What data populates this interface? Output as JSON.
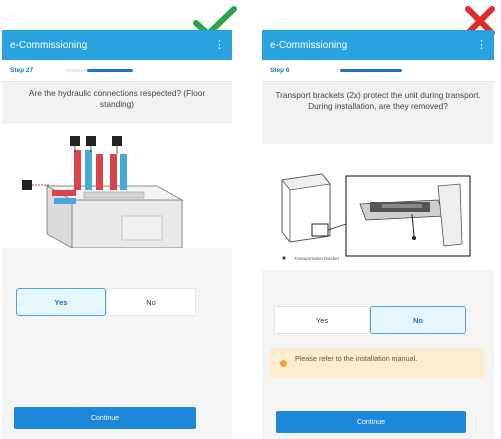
{
  "left_screen": {
    "verdict_icon": "checkmark-icon",
    "verdict_color": "#2aa448",
    "app_title": "e-Commissioning",
    "step_label": "Step 27",
    "question": "Are the hydraulic connections respected? (Floor standing)",
    "choices": {
      "yes": "Yes",
      "no": "No"
    },
    "selected": "yes",
    "continue_label": "Continue"
  },
  "right_screen": {
    "verdict_icon": "cross-icon",
    "verdict_color": "#e02b2b",
    "app_title": "e-Commissioning",
    "step_label": "Step 6",
    "question": "Transport brackets (2x) protect the unit during transport. During installation, are they removed?",
    "figure_caption": "Transportation bracket",
    "choices": {
      "yes": "Yes",
      "no": "No"
    },
    "selected": "no",
    "info_message": "Please refer to the installation manual.",
    "continue_label": "Continue"
  },
  "colors": {
    "appbar": "#29a3e0",
    "primary": "#1d87d9",
    "selected_border": "#4aa6de",
    "info_bg": "#fdeccd",
    "info_icon": "#f0a232"
  }
}
